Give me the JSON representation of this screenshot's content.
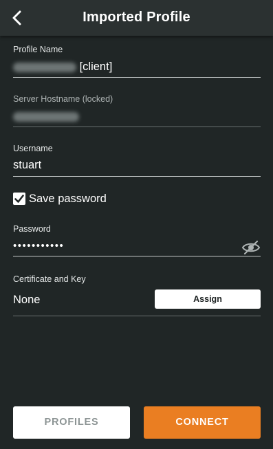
{
  "header": {
    "title": "Imported Profile",
    "back_icon": "chevron-left-icon"
  },
  "profile_name": {
    "label": "Profile Name",
    "value_suffix": "[client]"
  },
  "server_hostname": {
    "label": "Server Hostname (locked)"
  },
  "username": {
    "label": "Username",
    "value": "stuart"
  },
  "save_password": {
    "label": "Save password",
    "checked": true
  },
  "password": {
    "label": "Password",
    "value": "•••••••••••",
    "toggle_icon": "eye-slash-icon"
  },
  "certificate": {
    "label": "Certificate and Key",
    "value": "None",
    "assign_label": "Assign"
  },
  "footer": {
    "profiles_label": "PROFILES",
    "connect_label": "CONNECT"
  },
  "colors": {
    "background": "#202626",
    "header": "#2b3131",
    "accent": "#ea7e22"
  }
}
